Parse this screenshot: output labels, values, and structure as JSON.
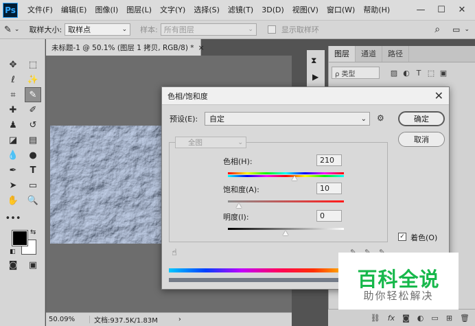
{
  "app": {
    "logo": "Ps"
  },
  "menu": {
    "items": [
      "文件(F)",
      "编辑(E)",
      "图像(I)",
      "图层(L)",
      "文字(Y)",
      "选择(S)",
      "滤镜(T)",
      "3D(D)",
      "视图(V)",
      "窗口(W)",
      "帮助(H)"
    ]
  },
  "window_controls": {
    "minimize": "—",
    "maximize": "☐",
    "close": "✕"
  },
  "options_bar": {
    "sample_size_label": "取样大小:",
    "sample_size_value": "取样点",
    "sample_label": "样本:",
    "sample_value": "所有图层",
    "show_ring_label": "显示取样环"
  },
  "document": {
    "tab_title": "未标题-1 @ 50.1% (图层 1 拷贝, RGB/8) *",
    "tab_close": "×",
    "zoom": "50.09%",
    "doc_info": "文档:937.5K/1.83M"
  },
  "layers_panel": {
    "tabs": [
      "图层",
      "通道",
      "路径"
    ],
    "filter_label": "ρ 类型"
  },
  "dialog": {
    "title": "色相/饱和度",
    "close": "✕",
    "preset_label": "预设(E):",
    "preset_value": "自定",
    "ok_label": "确定",
    "cancel_label": "取消",
    "channel_value": "全图",
    "hue": {
      "label": "色相(H):",
      "value": "210"
    },
    "saturation": {
      "label": "饱和度(A):",
      "value": "10"
    },
    "lightness": {
      "label": "明度(I):",
      "value": "0"
    },
    "colorize_label": "着色(O)",
    "colorize_checked": true
  },
  "watermark": {
    "title": "百科全说",
    "subtitle": "助你轻松解决",
    "color": "#17b84b"
  }
}
